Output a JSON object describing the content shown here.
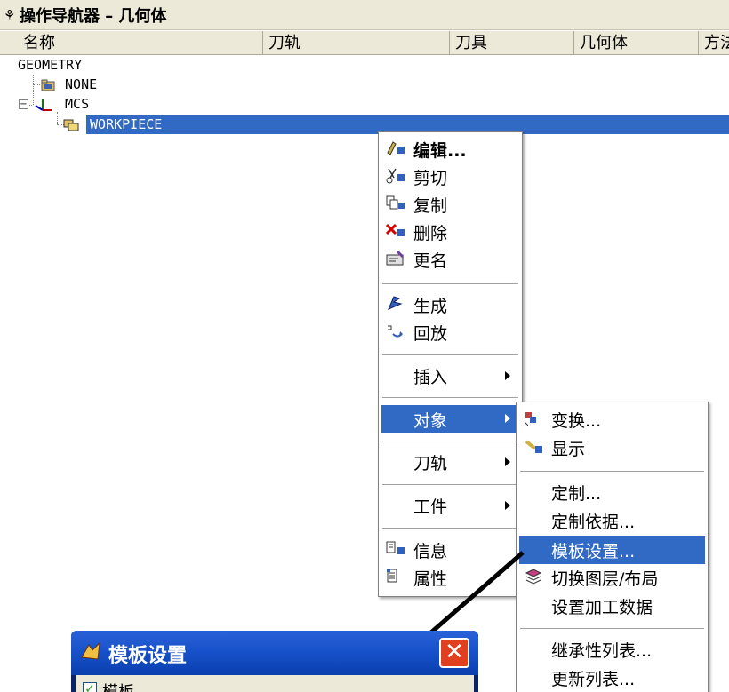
{
  "window": {
    "title": "操作导航器 – 几何体"
  },
  "columns": [
    "名称",
    "刀轨",
    "刀具",
    "几何体",
    "方法"
  ],
  "tree": {
    "root": "GEOMETRY",
    "none": "NONE",
    "mcs": "MCS",
    "workpiece": "WORKPIECE"
  },
  "context_menu": {
    "items": [
      "编辑...",
      "剪切",
      "复制",
      "删除",
      "更名",
      "生成",
      "回放",
      "插入",
      "对象",
      "刀轨",
      "工件",
      "信息",
      "属性"
    ],
    "highlighted": "对象"
  },
  "submenu": {
    "items": [
      "变换...",
      "显示",
      "定制...",
      "定制依据...",
      "模板设置...",
      "切换图层/布局",
      "设置加工数据",
      "继承性列表...",
      "更新列表..."
    ],
    "highlighted": "模板设置..."
  },
  "dialog": {
    "title": "模板设置",
    "checkbox_label": "模板",
    "checked": true
  },
  "colors": {
    "selection": "#316ac5",
    "menu_bg": "#ffffff",
    "chrome": "#ece9d8"
  }
}
